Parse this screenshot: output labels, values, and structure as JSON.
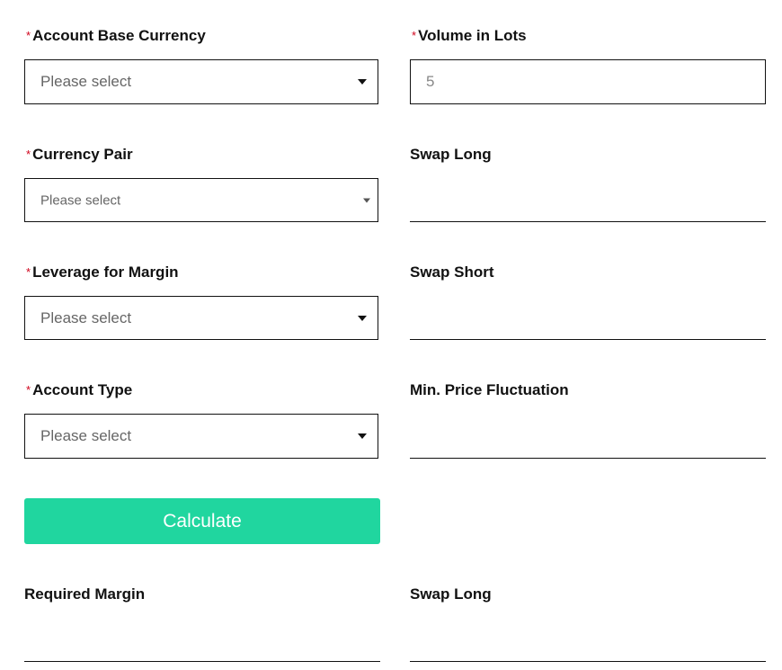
{
  "form": {
    "left": [
      {
        "label": "Account Base Currency",
        "required": true,
        "placeholder": "Please select"
      },
      {
        "label": "Currency Pair",
        "required": true,
        "placeholder": "Please select"
      },
      {
        "label": "Leverage for Margin",
        "required": true,
        "placeholder": "Please select"
      },
      {
        "label": "Account Type",
        "required": true,
        "placeholder": "Please select"
      }
    ],
    "right": [
      {
        "label": "Volume in Lots",
        "required": true,
        "value": "5"
      },
      {
        "label": "Swap Long",
        "required": false,
        "value": ""
      },
      {
        "label": "Swap Short",
        "required": false,
        "value": ""
      },
      {
        "label": "Min. Price Fluctuation",
        "required": false,
        "value": ""
      }
    ],
    "required_mark": "*",
    "calculate_label": "Calculate"
  },
  "results": [
    {
      "label": "Required Margin",
      "value": ""
    },
    {
      "label": "Swap Long",
      "value": ""
    }
  ],
  "colors": {
    "accent": "#20d69f",
    "required": "#d0021b"
  }
}
